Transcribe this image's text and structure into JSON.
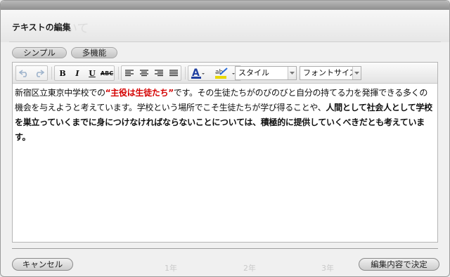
{
  "dialog": {
    "title": "テキストの編集",
    "background_heading": "いて"
  },
  "tabs": [
    {
      "label": "シンプル"
    },
    {
      "label": "多機能"
    }
  ],
  "toolbar": {
    "undo": "undo-icon",
    "redo": "redo-icon",
    "bold": "B",
    "italic": "I",
    "underline": "U",
    "strikethrough": "ABC",
    "style_select": "スタイル",
    "font_size_select": "フォントサイズ",
    "font_color": "#1f3fa0",
    "highlight_color": "#e8d800"
  },
  "content": {
    "segments": [
      {
        "text": "新宿区立東京中学校での",
        "style": "normal"
      },
      {
        "text": "“主役は生徒たち”",
        "style": "red-bold"
      },
      {
        "text": "です。その生徒たちがのびのびと自分の持てる力を発揮できる多くの機会を与えようと考えています。学校という場所でこそ生徒たちが学び得ることや、",
        "style": "normal"
      },
      {
        "text": "人間として社会人として学校を巣立っていくまでに身につけなければならないことについては、積極的に提供していくべきだとも考えています。",
        "style": "bold"
      }
    ]
  },
  "background": {
    "grades": [
      "1年",
      "2年",
      "3年"
    ]
  },
  "footer": {
    "cancel_label": "キャンセル",
    "confirm_label": "編集内容で決定"
  }
}
